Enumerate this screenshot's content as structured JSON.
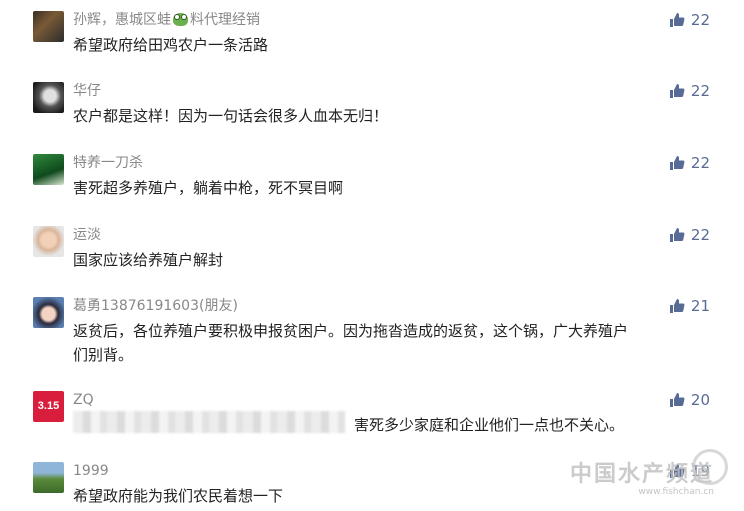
{
  "comments": [
    {
      "name": "孙辉，惠城区蛙",
      "name_suffix": "料代理经销",
      "text": "希望政府给田鸡农户一条活路",
      "likes": "22"
    },
    {
      "name": "华仔",
      "text": "农户都是这样！因为一句话会很多人血本无归！",
      "likes": "22"
    },
    {
      "name": "特养一刀杀",
      "text": "害死超多养殖户，躺着中枪，死不冥目啊",
      "likes": "22"
    },
    {
      "name": "运淡",
      "text": "国家应该给养殖户解封",
      "likes": "22"
    },
    {
      "name": "葛勇13876191603(朋友)",
      "text": "返贫后，各位养殖户要积极申报贫困户。因为拖沓造成的返贫，这个锅，广大养殖户们别背。",
      "likes": "21"
    },
    {
      "name": "ZQ",
      "text": "害死多少家庭和企业他们一点也不关心。",
      "likes": "20",
      "avatar_text": "3.15"
    },
    {
      "name": "1999",
      "text": "希望政府能为我们农民着想一下",
      "likes": "19"
    }
  ],
  "watermark": {
    "title": "中国水产频道",
    "url": "www.fishchan.cn"
  },
  "colors": {
    "like": "#576b95",
    "name": "#888888"
  }
}
